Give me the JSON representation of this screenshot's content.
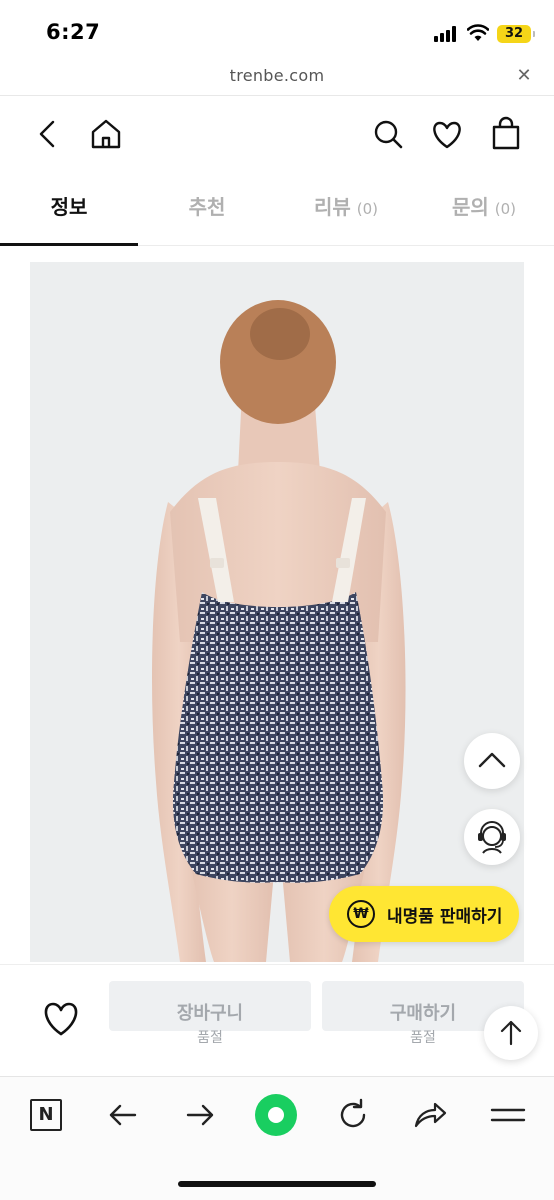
{
  "status_bar": {
    "time": "6:27",
    "battery": "32"
  },
  "url_bar": {
    "url": "trenbe.com",
    "close_icon": "close-icon"
  },
  "header": {
    "icons": [
      "back-icon",
      "home-icon",
      "search-icon",
      "heart-icon",
      "shopping-bag-icon"
    ]
  },
  "tabs": [
    {
      "label": "정보",
      "count": "",
      "active": true
    },
    {
      "label": "추천",
      "count": "",
      "active": false
    },
    {
      "label": "리뷰",
      "count": "(0)",
      "active": false
    },
    {
      "label": "문의",
      "count": "(0)",
      "active": false
    }
  ],
  "floating": {
    "scroll_up_icon": "chevron-up-icon",
    "support_icon": "headset-agent-icon",
    "sell_coin": "₩",
    "sell_label": "내명품 판매하기",
    "top_icon": "arrow-up-icon"
  },
  "actions": {
    "cart_label": "장바구니",
    "cart_status": "품절",
    "buy_label": "구매하기",
    "buy_status": "품절",
    "wish_icon": "heart-outline-icon"
  },
  "browser_toolbar": {
    "naver_badge": "N",
    "icons": [
      "naver-icon",
      "back-arrow-icon",
      "forward-arrow-icon",
      "green-dot-icon",
      "reload-icon",
      "share-icon",
      "menu-icon"
    ],
    "accent": "#19ce60"
  },
  "colors": {
    "sell_button": "#ffe633",
    "disabled_button": "#eef0f2",
    "battery": "#f5d518"
  }
}
